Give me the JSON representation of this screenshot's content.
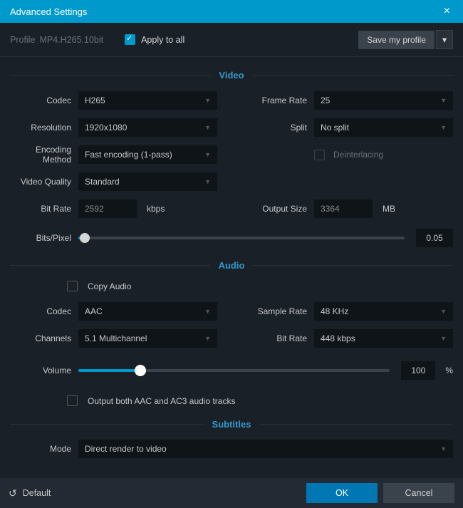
{
  "window": {
    "title": "Advanced Settings"
  },
  "profile": {
    "label": "Profile",
    "value": "MP4.H265.10bit",
    "apply_label": "Apply to all",
    "save_label": "Save my profile"
  },
  "sections": {
    "video": "Video",
    "audio": "Audio",
    "subtitles": "Subtitles"
  },
  "video": {
    "codec_label": "Codec",
    "codec_value": "H265",
    "resolution_label": "Resolution",
    "resolution_value": "1920x1080",
    "encoding_label": "Encoding Method",
    "encoding_value": "Fast encoding (1-pass)",
    "quality_label": "Video Quality",
    "quality_value": "Standard",
    "framerate_label": "Frame Rate",
    "framerate_value": "25",
    "split_label": "Split",
    "split_value": "No split",
    "deinterlacing_label": "Deinterlacing",
    "bitrate_label": "Bit Rate",
    "bitrate_value": "2592",
    "bitrate_unit": "kbps",
    "outputsize_label": "Output Size",
    "outputsize_value": "3364",
    "outputsize_unit": "MB",
    "bitspixel_label": "Bits/Pixel",
    "bitspixel_value": "0.05"
  },
  "audio": {
    "copy_label": "Copy Audio",
    "codec_label": "Codec",
    "codec_value": "AAC",
    "channels_label": "Channels",
    "channels_value": "5.1 Multichannel",
    "samplerate_label": "Sample Rate",
    "samplerate_value": "48 KHz",
    "bitrate_label": "Bit Rate",
    "bitrate_value": "448 kbps",
    "volume_label": "Volume",
    "volume_value": "100",
    "volume_unit": "%",
    "output_both_label": "Output both AAC and AC3 audio tracks"
  },
  "subtitles": {
    "mode_label": "Mode",
    "mode_value": "Direct render to video"
  },
  "footer": {
    "default_label": "Default",
    "ok_label": "OK",
    "cancel_label": "Cancel"
  }
}
